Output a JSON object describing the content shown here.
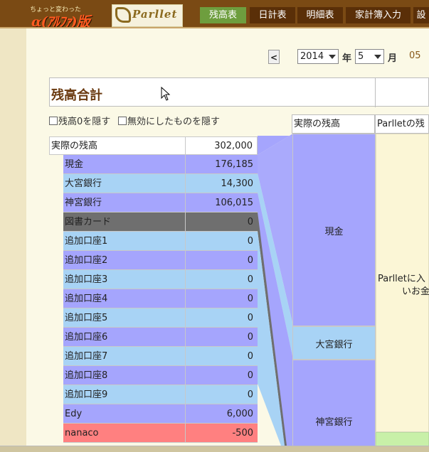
{
  "header": {
    "logo_small_text": "ちょっと変わった",
    "logo_big_text": "α(ｱﾙﾌｧ)版",
    "logo2_text": "Parllet",
    "tabs": [
      {
        "label": "残高表",
        "active": true
      },
      {
        "label": "日計表",
        "active": false
      },
      {
        "label": "明細表",
        "active": false
      },
      {
        "label": "家計簿入力",
        "active": false
      },
      {
        "label": "設",
        "active": false
      }
    ]
  },
  "date_nav": {
    "prev_label": "<",
    "year_value": "2014",
    "year_label": "年",
    "month_value": "5",
    "month_label": "月",
    "day_text": "05"
  },
  "summary": {
    "title": "残高合計"
  },
  "filters": {
    "hide_zero_label": "残高0を隠す",
    "hide_disabled_label": "無効にしたものを隠す"
  },
  "left_table": {
    "header": {
      "name": "実際の残高",
      "value": "302,000"
    },
    "rows": [
      {
        "name": "現金",
        "value": "176,185",
        "color": "#a5a5fd"
      },
      {
        "name": "大宮銀行",
        "value": "14,300",
        "color": "#a8d3f5"
      },
      {
        "name": "神宮銀行",
        "value": "106,015",
        "color": "#a5a5fd"
      },
      {
        "name": "図書カード",
        "value": "0",
        "color": "#6f6f6f"
      },
      {
        "name": "追加口座1",
        "value": "0",
        "color": "#a8d3f5"
      },
      {
        "name": "追加口座2",
        "value": "0",
        "color": "#a5a5fd"
      },
      {
        "name": "追加口座3",
        "value": "0",
        "color": "#a8d3f5"
      },
      {
        "name": "追加口座4",
        "value": "0",
        "color": "#a5a5fd"
      },
      {
        "name": "追加口座5",
        "value": "0",
        "color": "#a8d3f5"
      },
      {
        "name": "追加口座6",
        "value": "0",
        "color": "#a5a5fd"
      },
      {
        "name": "追加口座7",
        "value": "0",
        "color": "#a8d3f5"
      },
      {
        "name": "追加口座8",
        "value": "0",
        "color": "#a5a5fd"
      },
      {
        "name": "追加口座9",
        "value": "0",
        "color": "#a8d3f5"
      },
      {
        "name": "Edy",
        "value": "6,000",
        "color": "#a5a5fd"
      },
      {
        "name": "nanaco",
        "value": "-500",
        "color": "#ff8080"
      }
    ]
  },
  "right_panel": {
    "header_left": "実際の残高",
    "header_right": "Parlletの残",
    "boxes": [
      {
        "label": "現金",
        "color": "#a5a5fd"
      },
      {
        "label": "大宮銀行",
        "color": "#a8d3f5"
      },
      {
        "label": "神宮銀行",
        "color": "#a5a5fd"
      }
    ],
    "note_line1": "Parlletに入",
    "note_line2": "いお金",
    "note_bg": "#fbf6d6"
  },
  "colors": {
    "header_bg": "#7a4a14",
    "tab_active": "#6e9e3e",
    "tab_normal": "#5a2f08",
    "title_text": "#6b3a10"
  }
}
